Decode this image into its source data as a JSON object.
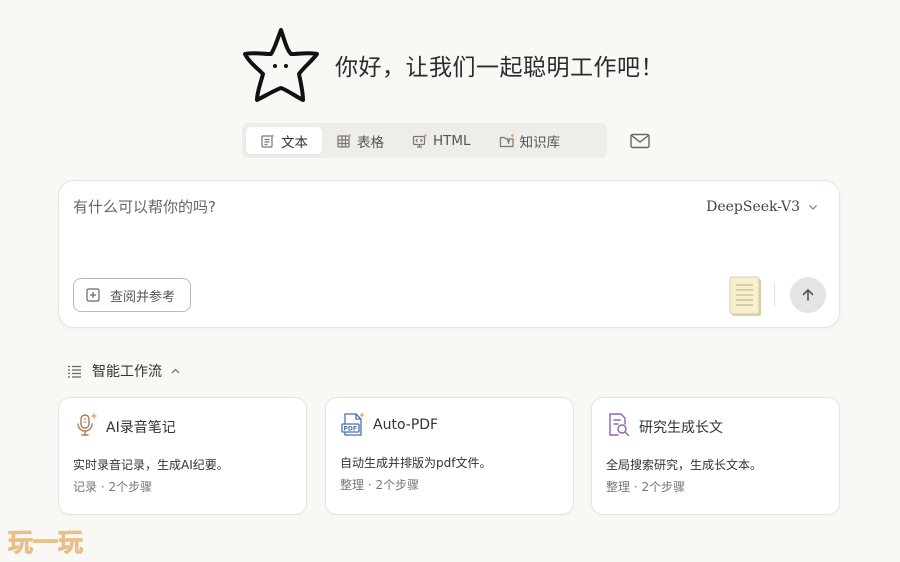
{
  "hero": {
    "greeting": "你好，让我们一起聪明工作吧！"
  },
  "tabs": [
    {
      "label": "文本",
      "icon": "text-doc-icon",
      "active": true
    },
    {
      "label": "表格",
      "icon": "table-icon",
      "active": false
    },
    {
      "label": "HTML",
      "icon": "html-icon",
      "active": false
    },
    {
      "label": "知识库",
      "icon": "folder-icon",
      "active": false
    }
  ],
  "mail": {
    "icon": "mail-icon"
  },
  "composer": {
    "placeholder": "有什么可以帮你的吗?",
    "model": "DeepSeek-V3",
    "ref_button_label": "查阅并参考"
  },
  "workflow": {
    "title": "智能工作流",
    "cards": [
      {
        "title": "AI录音笔记",
        "desc": "实时录音记录，生成AI纪要。",
        "meta": "记录 · 2个步骤",
        "icon": "microphone-icon"
      },
      {
        "title": "Auto-PDF",
        "desc": "自动生成并排版为pdf文件。",
        "meta": "整理 · 2个步骤",
        "icon": "pdf-icon"
      },
      {
        "title": "研究生成长文",
        "desc": "全局搜索研究，生成长文本。",
        "meta": "整理 · 2个步骤",
        "icon": "search-doc-icon"
      }
    ]
  },
  "watermark": {
    "text": "玩一玩"
  },
  "colors": {
    "accent_orange": "#e0a36a",
    "mic_brown": "#b07856",
    "pdf_blue": "#4a6fb0",
    "research_purple": "#8a64b8"
  }
}
